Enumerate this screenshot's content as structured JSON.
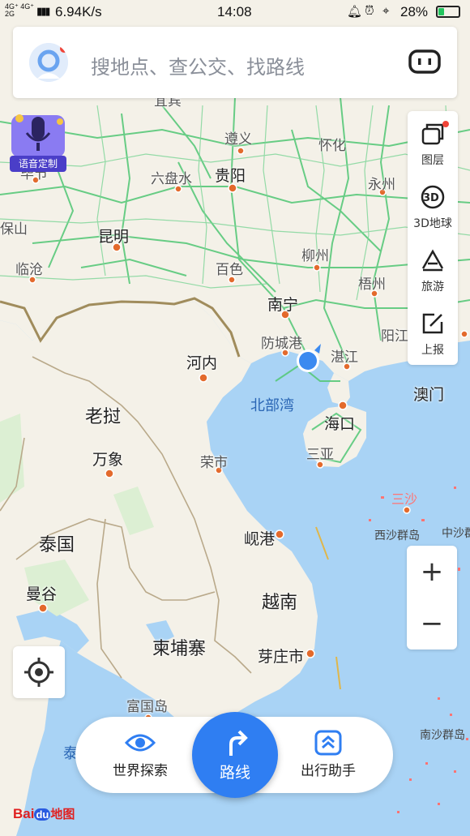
{
  "status_bar": {
    "network": "4G⁺ 4G⁺\n2G",
    "speed": "6.94K/s",
    "time": "14:08",
    "battery": "28%",
    "battery_level": 0.28
  },
  "search": {
    "placeholder": "搜地点、查公交、找路线"
  },
  "voice_badge": {
    "label": "语音定制"
  },
  "tools": [
    {
      "icon": "layers-icon",
      "label": "图层"
    },
    {
      "icon": "3d-globe-icon",
      "label": "3D地球"
    },
    {
      "icon": "travel-icon",
      "label": "旅游"
    },
    {
      "icon": "report-icon",
      "label": "上报"
    }
  ],
  "zoom": {
    "in": "+",
    "out": "−"
  },
  "map_labels": {
    "guiyang": "贵阳",
    "kunming": "昆明",
    "nanning": "南宁",
    "hanoi": "河内",
    "haikou": "海口",
    "laos": "老挝",
    "vientiane": "万象",
    "thailand": "泰国",
    "bangkok": "曼谷",
    "vietnam": "越南",
    "cambodia": "柬埔寨",
    "macau": "澳门",
    "beibu_gulf": "北部湾",
    "zunyi": "遵义",
    "huaihua": "怀化",
    "liupanshui": "六盘水",
    "yongzhou": "永州",
    "baise": "百色",
    "liuzhou": "柳州",
    "wuzhou": "梧州",
    "fangchenggang": "防城港",
    "zhanjiang": "湛江",
    "sanya": "三亚",
    "lincang": "临沧",
    "yangjiang": "阳江",
    "bijie": "毕节",
    "yibin": "宜宾",
    "baoshan": "保山",
    "vinh": "荣市",
    "danang": "岘港",
    "nhatrang": "芽庄市",
    "phuquoc": "富国岛",
    "sansha": "三沙",
    "xisha": "西沙群岛",
    "zhongsha": "中沙群岛",
    "nansha": "南沙群岛",
    "gulf_thailand": "泰"
  },
  "bottom_bar": {
    "explore_label": "世界探索",
    "route_label": "路线",
    "assistant_label": "出行助手"
  },
  "logo": {
    "text": "Bai",
    "text2": "du",
    "text3": "地图"
  },
  "colors": {
    "accent": "#2f7ef2",
    "sea": "#a9d3f5",
    "land": "#f5f3ee",
    "road": "#58c97a",
    "alert": "#f04438"
  }
}
